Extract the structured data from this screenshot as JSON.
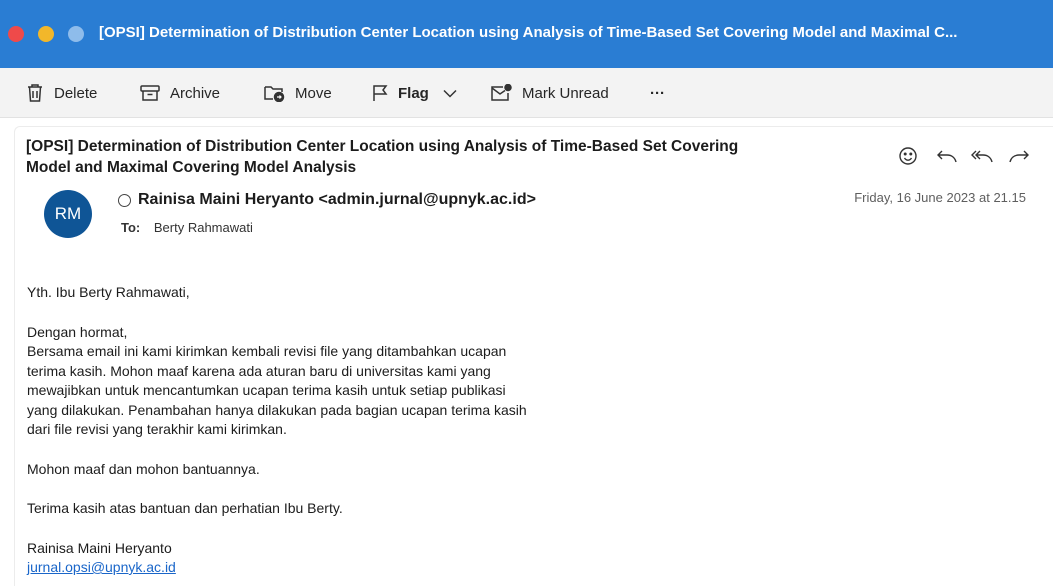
{
  "window": {
    "title": "[OPSI] Determination of Distribution Center Location using Analysis of Time-Based Set Covering Model and Maximal C..."
  },
  "toolbar": {
    "delete_label": "Delete",
    "archive_label": "Archive",
    "move_label": "Move",
    "flag_label": "Flag",
    "mark_unread_label": "Mark Unread",
    "more_label": "···"
  },
  "message": {
    "subject_line1": "[OPSI] Determination of Distribution Center Location using Analysis of Time-Based Set Covering",
    "subject_line2": "Model and Maximal Covering Model Analysis",
    "avatar_initials": "RM",
    "sender": "Rainisa Maini Heryanto <admin.jurnal@upnyk.ac.id>",
    "to_label": "To:",
    "recipient": "Berty Rahmawati",
    "date": "Friday, 16 June 2023 at 21.15",
    "body": {
      "greeting": "Yth. Ibu Berty Rahmawati,",
      "opening": "Dengan hormat,",
      "line1": "Bersama email ini kami kirimkan kembali revisi file yang ditambahkan ucapan",
      "line2": "terima kasih. Mohon maaf karena ada aturan baru di universitas kami yang",
      "line3": "mewajibkan untuk mencantumkan ucapan terima kasih untuk setiap publikasi",
      "line4": "yang dilakukan. Penambahan hanya dilakukan pada bagian ucapan terima kasih",
      "line5": "dari file revisi yang terakhir kami kirimkan.",
      "apology": "Mohon maaf dan mohon bantuannya.",
      "thanks": "Terima kasih atas bantuan dan perhatian Ibu Berty.",
      "signature_name": "Rainisa Maini Heryanto",
      "signature_email": "jurnal.opsi@upnyk.ac.id"
    }
  },
  "colors": {
    "titlebar": "#2a7dd3",
    "avatar": "#0f5596",
    "link": "#1a66c9"
  },
  "icons": [
    "trash-icon",
    "archive-icon",
    "folder-move-icon",
    "flag-icon",
    "chevron-down-icon",
    "envelope-unread-icon",
    "emoji-icon",
    "reply-icon",
    "reply-all-icon",
    "forward-icon"
  ]
}
